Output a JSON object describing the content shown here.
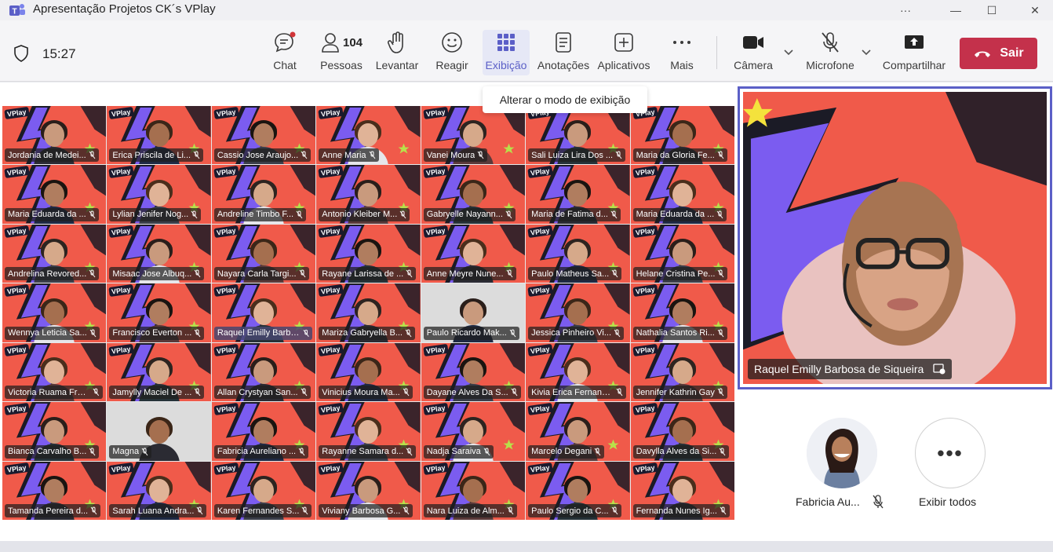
{
  "window": {
    "title": "Apresentação Projetos CK´s VPlay",
    "controls": {
      "more": "···",
      "minimize": "—",
      "maximize": "☐",
      "close": "✕"
    }
  },
  "meeting": {
    "time": "15:27"
  },
  "toolbar": {
    "chat": "Chat",
    "people": "Pessoas",
    "people_count": "104",
    "raise": "Levantar",
    "react": "Reagir",
    "view": "Exibição",
    "notes": "Anotações",
    "apps": "Aplicativos",
    "more": "Mais",
    "camera": "Câmera",
    "mic": "Microfone",
    "share": "Compartilhar",
    "leave": "Sair"
  },
  "tooltip": "Alterar o modo de exibição",
  "participants": [
    "Jordania de Medei...",
    "Erica Priscila de Li...",
    "Cassio Jose Araujo...",
    "Anne Maria",
    "Vanei Moura",
    "Sali Luiza Lira Dos ...",
    "Maria da Gloria Fe...",
    "Maria Eduarda da ...",
    "Lylian Jenifer Nog...",
    "Andreline Timbo F...",
    "Antonio Kleiber M...",
    "Gabryelle Nayann...",
    "Maria de Fatima d...",
    "Maria Eduarda da ...",
    "Andrelina Revored...",
    "Misaac Jose Albuq...",
    "Nayara Carla Targi...",
    "Rayane Larissa de ...",
    "Anne Meyre Nune...",
    "Paulo Matheus Sa...",
    "Helane Cristina Pe...",
    "Wennya Leticia Sa...",
    "Francisco Everton ...",
    "Raquel Emilly Barbos...",
    "Mariza Gabryella B...",
    "Paulo Ricardo Mak...",
    "Jessica Pinheiro Vi...",
    "Nathalia Santos Ri...",
    "Victoria Ruama Freit...",
    "Jamylly Maciel De ...",
    "Allan Crystyan San...",
    "Vinicius Moura Ma...",
    "Dayane Alves Da S...",
    "Kivia Erica Fernand...",
    "Jennifer Kathrin Gay",
    "Bianca Carvalho B...",
    "Magna",
    "Fabricia Aureliano ...",
    "Rayanne Samara d...",
    "Nadja Saraiva",
    "Marcelo Degani",
    "Davylla Alves da Si...",
    "Tamanda Pereira d...",
    "Sarah Luana Andra...",
    "Karen Fernandes S...",
    "Viviany Barbosa G...",
    "Nara Luiza de Alm...",
    "Paulo Sergio da C...",
    "Fernanda Nunes Ig..."
  ],
  "tile_logo": "VPlay",
  "spotlight": {
    "name": "Raquel Emilly Barbosa de Siqueira"
  },
  "mini": {
    "person": "Fabricia Au...",
    "show_all": "Exibir todos",
    "more_glyph": "•••"
  },
  "colors": {
    "accent": "#5b5fc7",
    "leave": "#c4314b",
    "tile_bg": "#f05a4a",
    "tile_shape": "#7b5cf0"
  }
}
